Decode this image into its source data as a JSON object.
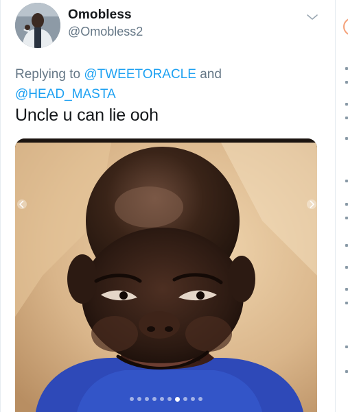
{
  "tweet": {
    "author_name": "Omobless",
    "author_handle": "@Omobless2",
    "reply_prefix": "Replying to ",
    "reply_mention_1": "@TWEETORACLE",
    "reply_joiner": " and",
    "reply_mention_2": "@HEAD_MASTA",
    "text": "Uncle u can lie ooh"
  },
  "media": {
    "carousel_total": 10,
    "carousel_current": 7
  },
  "icons": {
    "menu": "chevron-down-icon",
    "prev": "chevron-left-icon",
    "next": "chevron-right-icon"
  },
  "colors": {
    "link": "#1da1f2",
    "secondary_text": "#657786",
    "primary_text": "#14171a"
  }
}
